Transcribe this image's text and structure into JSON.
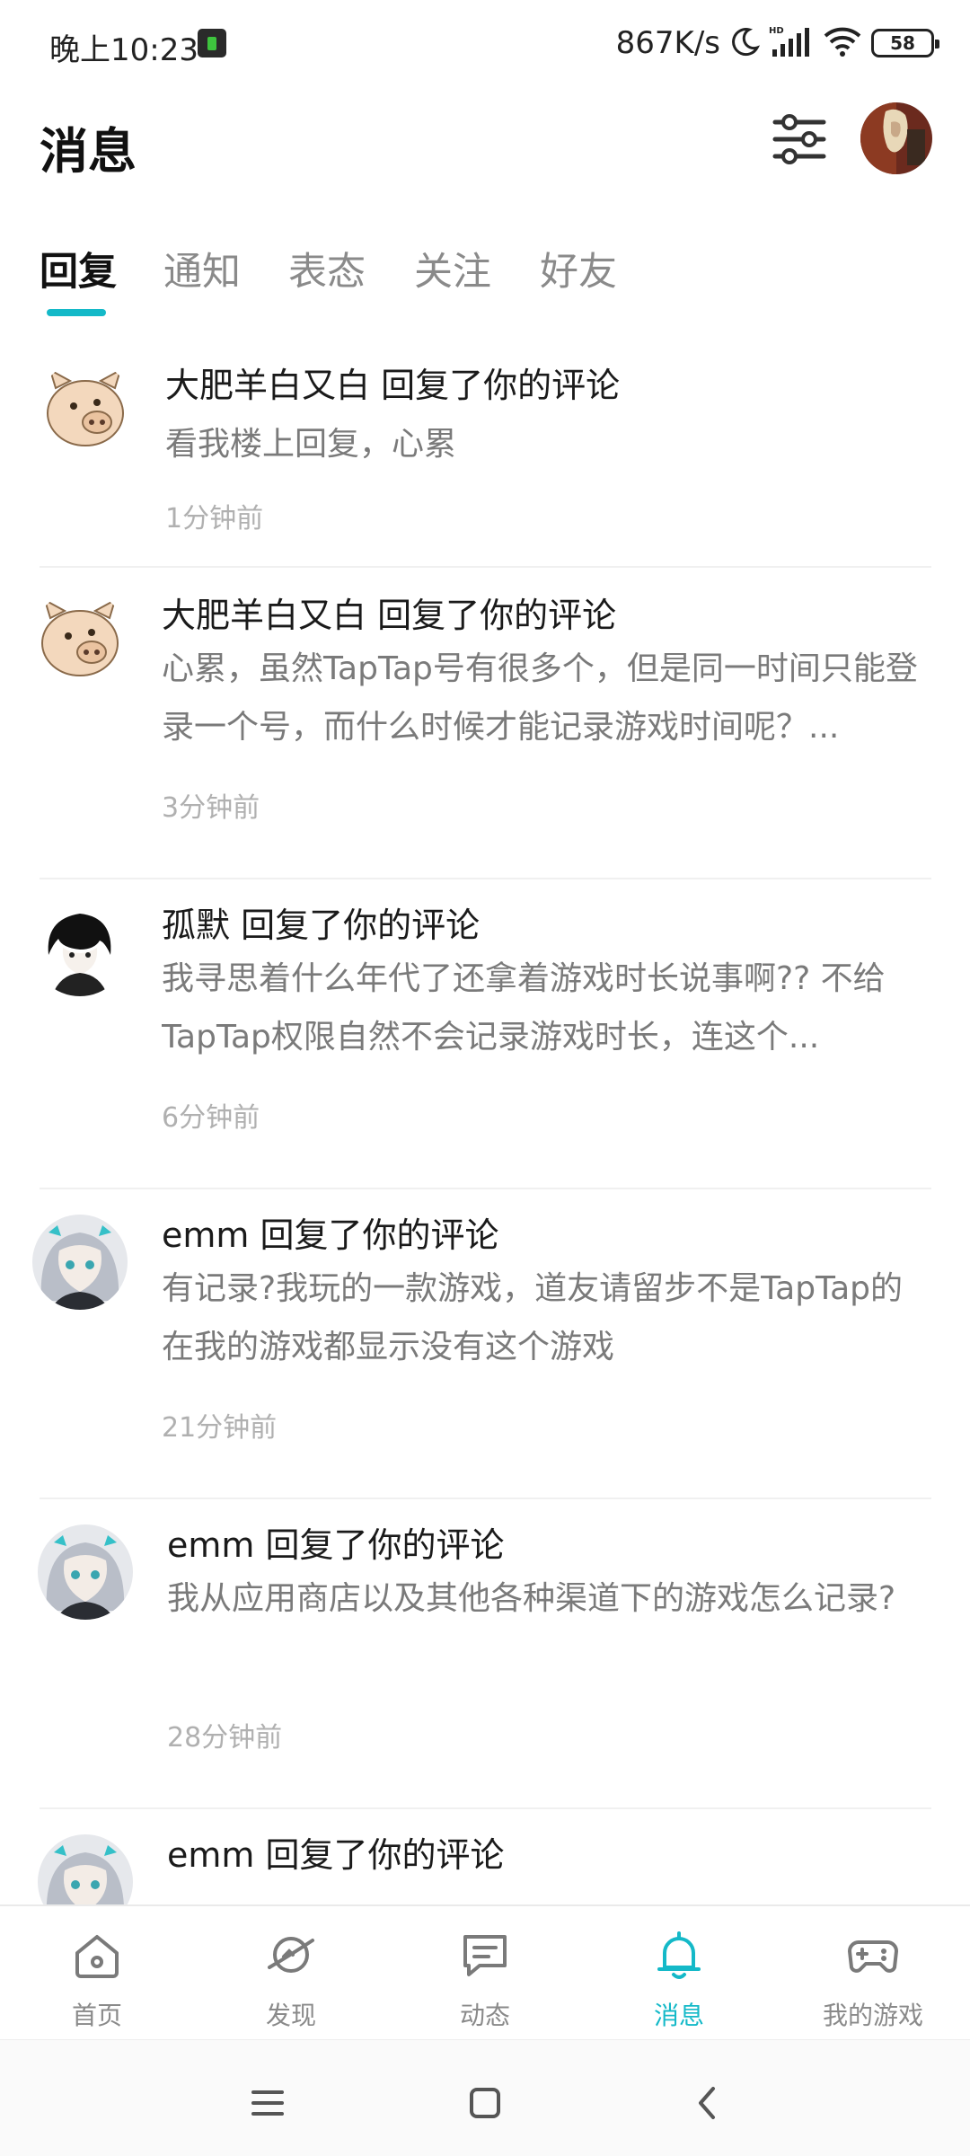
{
  "status_bar": {
    "time": "晚上10:23",
    "net_speed": "867K/s",
    "signal_label": "HD",
    "battery": "58"
  },
  "header": {
    "title": "消息",
    "filter_icon": "sliders-icon",
    "avatar_icon": "user-avatar"
  },
  "tabs": [
    {
      "label": "回复",
      "active": true
    },
    {
      "label": "通知",
      "active": false
    },
    {
      "label": "表态",
      "active": false
    },
    {
      "label": "关注",
      "active": false
    },
    {
      "label": "好友",
      "active": false
    }
  ],
  "messages": [
    {
      "avatar": "pig-avatar",
      "title": "大肥羊白又白 回复了你的评论",
      "body": "看我楼上回复，心累",
      "time": "1分钟前"
    },
    {
      "avatar": "pig-avatar",
      "title": "大肥羊白又白 回复了你的评论",
      "body": "心累，虽然TapTap号有很多个，但是同一时间只能登录一个号，而什么时候才能记录游戏时间呢？...",
      "time": "3分钟前"
    },
    {
      "avatar": "anime-boy-avatar",
      "title": "孤默 回复了你的评论",
      "body": "我寻思着什么年代了还拿着游戏时长说事啊?? 不给TapTap权限自然不会记录游戏时长，连这个...",
      "time": "6分钟前"
    },
    {
      "avatar": "anime-girl-avatar",
      "title": "emm 回复了你的评论",
      "body": "有记录?我玩的一款游戏，道友请留步不是TapTap的在我的游戏都显示没有这个游戏",
      "time": "21分钟前"
    },
    {
      "avatar": "anime-girl-avatar",
      "title": "emm 回复了你的评论",
      "body": "我从应用商店以及其他各种渠道下的游戏怎么记录?",
      "time": "28分钟前"
    },
    {
      "avatar": "anime-girl-avatar",
      "title": "emm 回复了你的评论",
      "body": "",
      "time": ""
    }
  ],
  "bottom_nav": [
    {
      "label": "首页",
      "icon": "home-icon",
      "active": false
    },
    {
      "label": "发现",
      "icon": "planet-icon",
      "active": false
    },
    {
      "label": "动态",
      "icon": "chat-card-icon",
      "active": false
    },
    {
      "label": "消息",
      "icon": "bell-icon",
      "active": true
    },
    {
      "label": "我的游戏",
      "icon": "gamepad-icon",
      "active": false
    }
  ],
  "system_nav": [
    "menu-icon",
    "home-square-icon",
    "back-icon"
  ],
  "colors": {
    "accent": "#14b9c8",
    "text_primary": "#1a1a1a",
    "text_secondary": "#7a7a7a",
    "text_muted": "#b0b0b0"
  }
}
